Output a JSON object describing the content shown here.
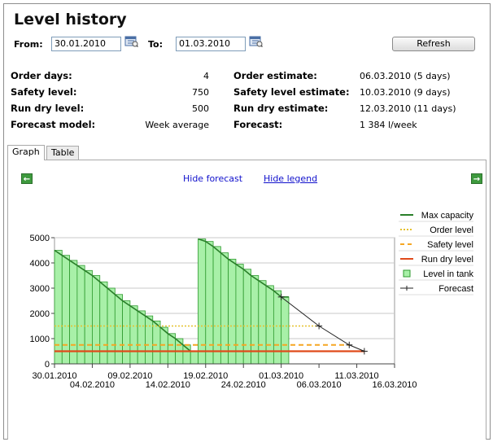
{
  "title": "Level history",
  "from_label": "From:",
  "from_value": "30.01.2010",
  "to_label": "To:",
  "to_value": "01.03.2010",
  "refresh_label": "Refresh",
  "info": {
    "left": [
      {
        "label": "Order days:",
        "value": "4"
      },
      {
        "label": "Safety level:",
        "value": "750"
      },
      {
        "label": "Run dry level:",
        "value": "500"
      },
      {
        "label": "Forecast model:",
        "value": "Week average"
      }
    ],
    "right": [
      {
        "label": "Order estimate:",
        "value": "06.03.2010 (5 days)"
      },
      {
        "label": "Safety level estimate:",
        "value": "10.03.2010 (9 days)"
      },
      {
        "label": "Run dry estimate:",
        "value": "12.03.2010 (11 days)"
      },
      {
        "label": "Forecast:",
        "value": "1 384 l/week"
      }
    ]
  },
  "tabs": [
    {
      "label": "Graph",
      "active": true
    },
    {
      "label": "Table",
      "active": false
    }
  ],
  "links": {
    "hide_forecast": "Hide forecast",
    "hide_legend": "Hide legend"
  },
  "icons": {
    "prev": "arrow-left-icon",
    "next": "arrow-right-icon",
    "calendar": "calendar-icon"
  },
  "chart_data": {
    "type": "bar",
    "ylim": [
      0,
      5000
    ],
    "yticks": [
      0,
      1000,
      2000,
      3000,
      4000,
      5000
    ],
    "xlim": [
      "30.01.2010",
      "16.03.2010"
    ],
    "xticks_top": [
      "30.01.2010",
      "09.02.2010",
      "19.02.2010",
      "01.03.2010",
      "11.03.2010"
    ],
    "xticks_bottom": [
      "04.02.2010",
      "14.02.2010",
      "24.02.2010",
      "06.03.2010",
      "16.03.2010"
    ],
    "grid": true,
    "legend_position": "right",
    "legend": [
      {
        "label": "Max capacity",
        "color": "#2a7f2a",
        "style": "solid"
      },
      {
        "label": "Order level",
        "color": "#e6c12c",
        "style": "dotted"
      },
      {
        "label": "Safety level",
        "color": "#f5a623",
        "style": "dashed"
      },
      {
        "label": "Run dry level",
        "color": "#e04a1a",
        "style": "solid"
      },
      {
        "label": "Level in tank",
        "color": "#7be07b",
        "style": "box"
      },
      {
        "label": "Forecast",
        "color": "#222222",
        "style": "cross"
      }
    ],
    "order_level": 1500,
    "safety_level": 750,
    "run_dry_level": 500,
    "level_in_tank": {
      "dates": [
        "30.01",
        "31.01",
        "01.02",
        "02.02",
        "03.02",
        "04.02",
        "05.02",
        "06.02",
        "07.02",
        "08.02",
        "09.02",
        "10.02",
        "11.02",
        "12.02",
        "13.02",
        "14.02",
        "15.02",
        "16.02",
        "17.02",
        "18.02",
        "19.02",
        "20.02",
        "21.02",
        "22.02",
        "23.02",
        "24.02",
        "25.02",
        "26.02",
        "27.02",
        "28.02",
        "01.03"
      ],
      "values": [
        4500,
        4300,
        4100,
        3900,
        3700,
        3500,
        3250,
        3000,
        2750,
        2500,
        2300,
        2100,
        1900,
        1700,
        1450,
        1200,
        1000,
        750,
        500,
        4950,
        4850,
        4650,
        4400,
        4150,
        3950,
        3750,
        3500,
        3300,
        3100,
        2900,
        2650
      ]
    },
    "forecast": {
      "dates": [
        "01.03.2010",
        "06.03.2010",
        "10.03.2010",
        "12.03.2010"
      ],
      "values": [
        2650,
        1500,
        750,
        500
      ]
    }
  }
}
